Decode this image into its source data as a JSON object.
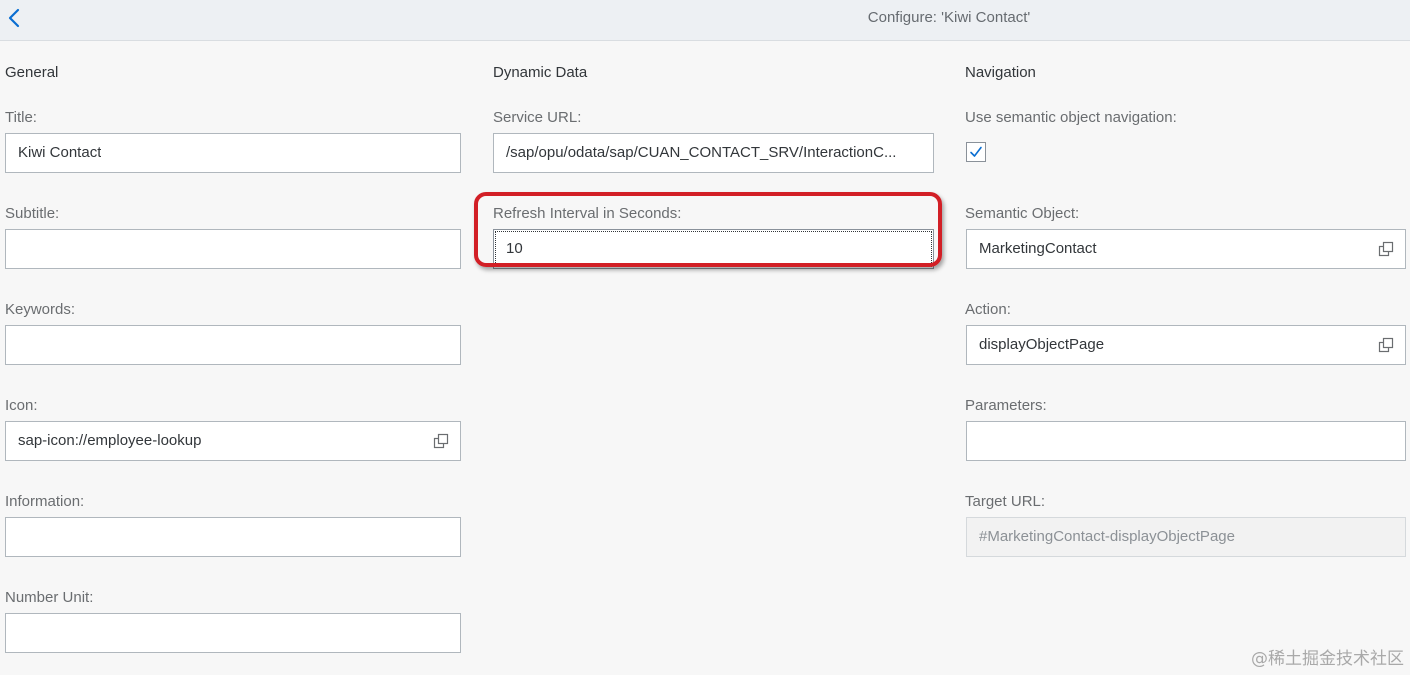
{
  "header": {
    "title": "Configure: 'Kiwi Contact'"
  },
  "general": {
    "heading": "General",
    "title_label": "Title:",
    "title_value": "Kiwi Contact",
    "subtitle_label": "Subtitle:",
    "subtitle_value": "",
    "keywords_label": "Keywords:",
    "keywords_value": "",
    "icon_label": "Icon:",
    "icon_value": "sap-icon://employee-lookup",
    "information_label": "Information:",
    "information_value": "",
    "number_unit_label": "Number Unit:",
    "number_unit_value": ""
  },
  "dynamic": {
    "heading": "Dynamic Data",
    "service_url_label": "Service URL:",
    "service_url_value": "/sap/opu/odata/sap/CUAN_CONTACT_SRV/InteractionC...",
    "refresh_label": "Refresh Interval in Seconds:",
    "refresh_value": "10"
  },
  "navigation": {
    "heading": "Navigation",
    "semantic_nav_label": "Use semantic object navigation:",
    "semantic_nav_checked": true,
    "semantic_object_label": "Semantic Object:",
    "semantic_object_value": "MarketingContact",
    "action_label": "Action:",
    "action_value": "displayObjectPage",
    "parameters_label": "Parameters:",
    "parameters_value": "",
    "target_url_label": "Target URL:",
    "target_url_value": "#MarketingContact-displayObjectPage"
  },
  "watermark": "@稀土掘金技术社区",
  "icons": {
    "back": "chevron-left-icon",
    "value_help": "value-help-icon",
    "check": "checkmark-icon"
  },
  "colors": {
    "highlight": "#d21f26",
    "accent": "#0a6ed1"
  }
}
